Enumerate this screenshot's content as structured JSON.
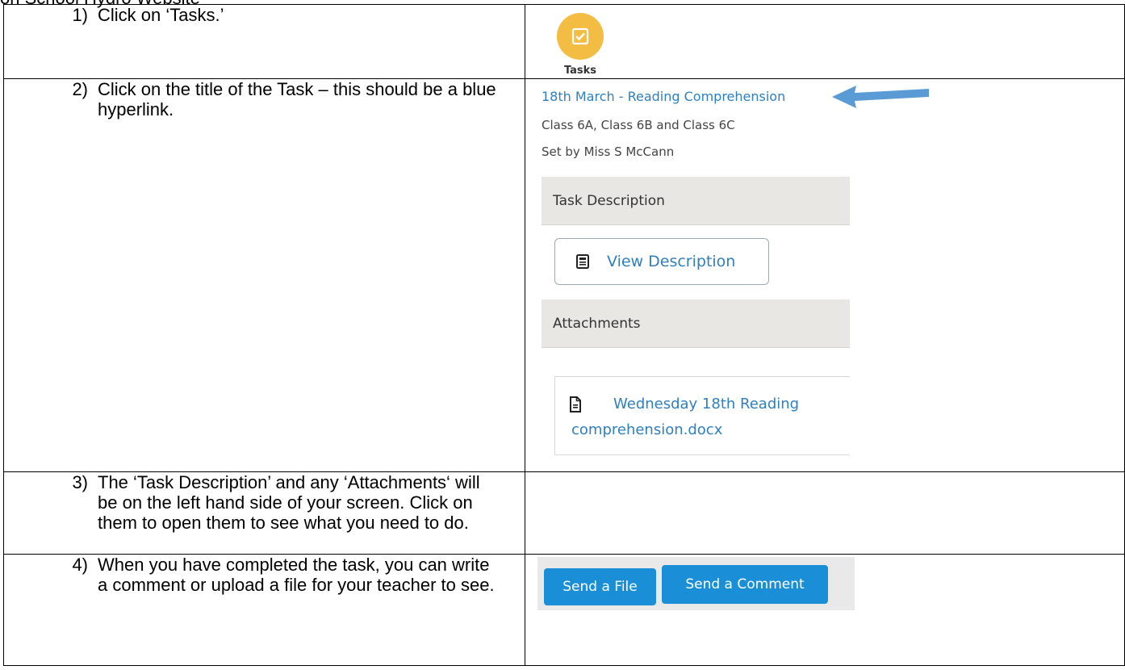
{
  "heading_fragment": "on School Hydro Website",
  "steps": [
    {
      "num": "1)",
      "text": "Click on ‘Tasks.’"
    },
    {
      "num": "2)",
      "text": "Click on the title of the Task – this should be a blue hyperlink."
    },
    {
      "num": "3)",
      "text": "The ‘Task Description’ and any ‘Attachments‘ will be on the left hand side of your screen. Click on them to open them to see what you need to do."
    },
    {
      "num": "4)",
      "text": "When you have completed the task, you can write a comment or upload a file for your teacher to see."
    }
  ],
  "tasks_icon": {
    "label": "Tasks",
    "color": "#f2bd42"
  },
  "task_screen": {
    "title_link": "18th March - Reading Comprehension",
    "classes": "Class 6A, Class 6B and Class 6C",
    "set_by": "Set by Miss S McCann",
    "description_header": "Task Description",
    "view_description": "View Description",
    "attachments_header": "Attachments",
    "attachment_name": "Wednesday 18th Reading comprehension.docx",
    "link_color": "#2f7fbf",
    "arrow_color": "#5b9bd5"
  },
  "submit_buttons": {
    "send_file": "Send a File",
    "send_comment": "Send a Comment",
    "color": "#1a8fd8"
  }
}
